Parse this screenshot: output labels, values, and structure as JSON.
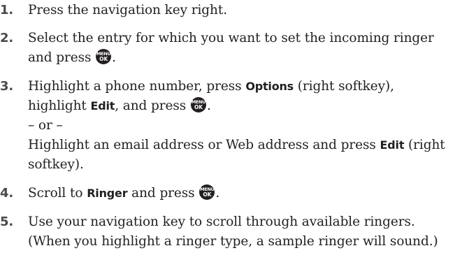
{
  "steps": [
    {
      "num": "1.",
      "line1": "Press the navigation key right."
    },
    {
      "num": "2.",
      "line1": "Select the entry for which you want to set the incoming ringer",
      "line2_pre": "and press",
      "line2_post": "."
    },
    {
      "num": "3.",
      "line1_pre": "Highlight a phone number, press",
      "options_key": "Options",
      "line1_post": "(right softkey),",
      "line2_pre": "highlight",
      "edit_key": "Edit",
      "line2_mid": ", and press",
      "line2_post": ".",
      "or_text": "– or –",
      "line4_pre": "Highlight an email address or Web address and press",
      "edit_key2": "Edit",
      "line4_post": "(right",
      "line5": "softkey)."
    },
    {
      "num": "4.",
      "line1_pre": "Scroll to",
      "ringer_key": "Ringer",
      "line1_mid": "and press",
      "line1_post": "."
    },
    {
      "num": "5.",
      "line1": "Use your navigation key to scroll through available ringers.",
      "line2": "(When you highlight a ringer type, a sample ringer will sound.)"
    }
  ],
  "menu_button": {
    "top_label": "MENU",
    "bottom_label": "OK",
    "icon": "menu-ok-button-icon"
  }
}
